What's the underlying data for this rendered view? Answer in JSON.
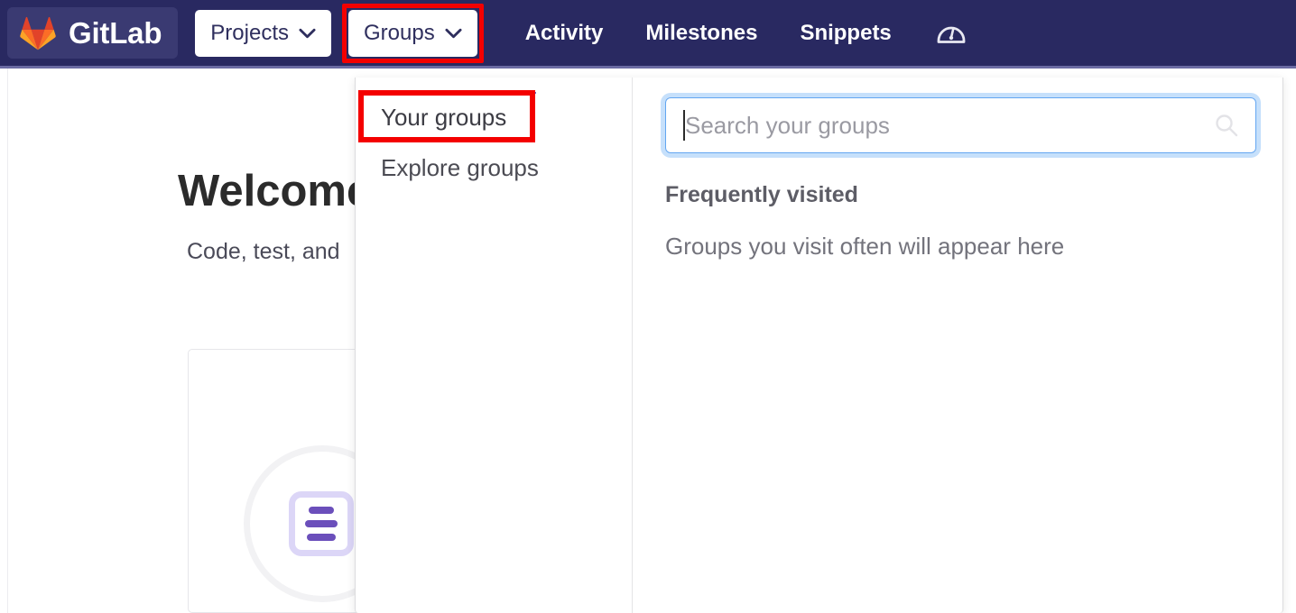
{
  "navbar": {
    "logo": {
      "label": "GitLab",
      "icon": "gitlab-tanuki-icon"
    },
    "pills": [
      {
        "label": "Projects",
        "icon": "chevron-down-icon",
        "highlighted": false
      },
      {
        "label": "Groups",
        "icon": "chevron-down-icon",
        "highlighted": true
      }
    ],
    "links": [
      {
        "label": "Activity"
      },
      {
        "label": "Milestones"
      },
      {
        "label": "Snippets"
      }
    ],
    "icon_button": {
      "name": "gauge-icon",
      "label": ""
    },
    "background_color": "#292961",
    "accent_color": "#3a3a72"
  },
  "highlight": {
    "color": "#f40000"
  },
  "dropdown": {
    "nav_items": [
      {
        "label": "Your groups",
        "active": true,
        "highlighted": true
      },
      {
        "label": "Explore groups",
        "active": false,
        "highlighted": false
      }
    ],
    "search": {
      "placeholder": "Search your groups",
      "value": "",
      "icon": "search-icon",
      "focus_ring_color": "#c6e0fb"
    },
    "frequently_visited": {
      "heading": "Frequently visited",
      "empty_message": "Groups you visit often will appear here"
    }
  },
  "page": {
    "title": "Welcome",
    "subtitle": "Code, test, and",
    "card_icon": "document-lines-icon",
    "card_icon_color": "#6b4fbb"
  }
}
